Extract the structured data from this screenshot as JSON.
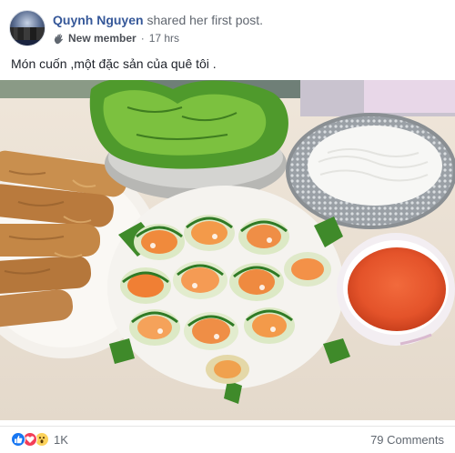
{
  "post": {
    "author": "Quynh Nguyen",
    "action": "shared her first post.",
    "badge": "New member",
    "separator": "·",
    "time": "17 hrs",
    "caption": "Món cuốn ,một đặc sản của quê tôi .",
    "photo_subject": "spring-rolls-photo"
  },
  "footer": {
    "reaction_icons": [
      "like-icon",
      "love-icon",
      "wow-icon"
    ],
    "reaction_count": "1K",
    "comments": "79 Comments"
  },
  "colors": {
    "author_link": "#365899",
    "secondary_text": "#616770",
    "like": "#1877f2",
    "love": "#f33e58",
    "wow": "#fcd25b"
  }
}
